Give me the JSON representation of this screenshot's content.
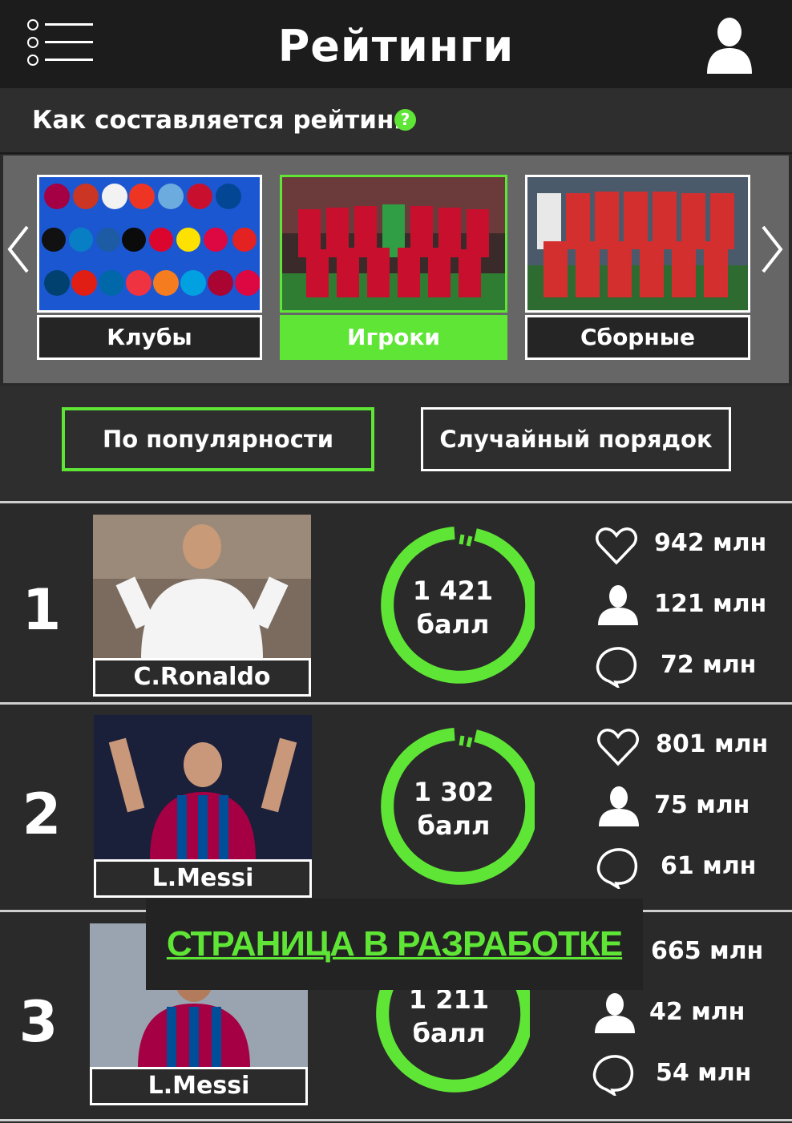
{
  "header": {
    "title": "Рейтинги",
    "menu_icon": "menu-icon",
    "profile_icon": "user-icon"
  },
  "info": {
    "text": "Как составляется рейтинг",
    "help_icon": "?"
  },
  "categories": [
    {
      "label": "Клубы",
      "active": false
    },
    {
      "label": "Игроки",
      "active": true
    },
    {
      "label": "Сборные",
      "active": false
    }
  ],
  "sort": {
    "popularity": "По популярности",
    "random": "Случайный порядок"
  },
  "rows": [
    {
      "rank": "1",
      "name": "C.Ronaldo",
      "score": "1 421",
      "score_unit": "балл",
      "likes": "942 млн",
      "followers": "121 млн",
      "comments": "72 млн"
    },
    {
      "rank": "2",
      "name": "L.Messi",
      "score": "1 302",
      "score_unit": "балл",
      "likes": "801 млн",
      "followers": "75 млн",
      "comments": "61 млн"
    },
    {
      "rank": "3",
      "name": "L.Messi",
      "score": "1 211",
      "score_unit": "балл",
      "likes": "665 млн",
      "followers": "42 млн",
      "comments": "54 млн"
    }
  ],
  "dev_notice": "СТРАНИЦА В РАЗРАБОТКЕ",
  "colors": {
    "accent": "#5fe536",
    "header_bg": "#1c1c1c",
    "body_bg": "#2a2a2a"
  }
}
